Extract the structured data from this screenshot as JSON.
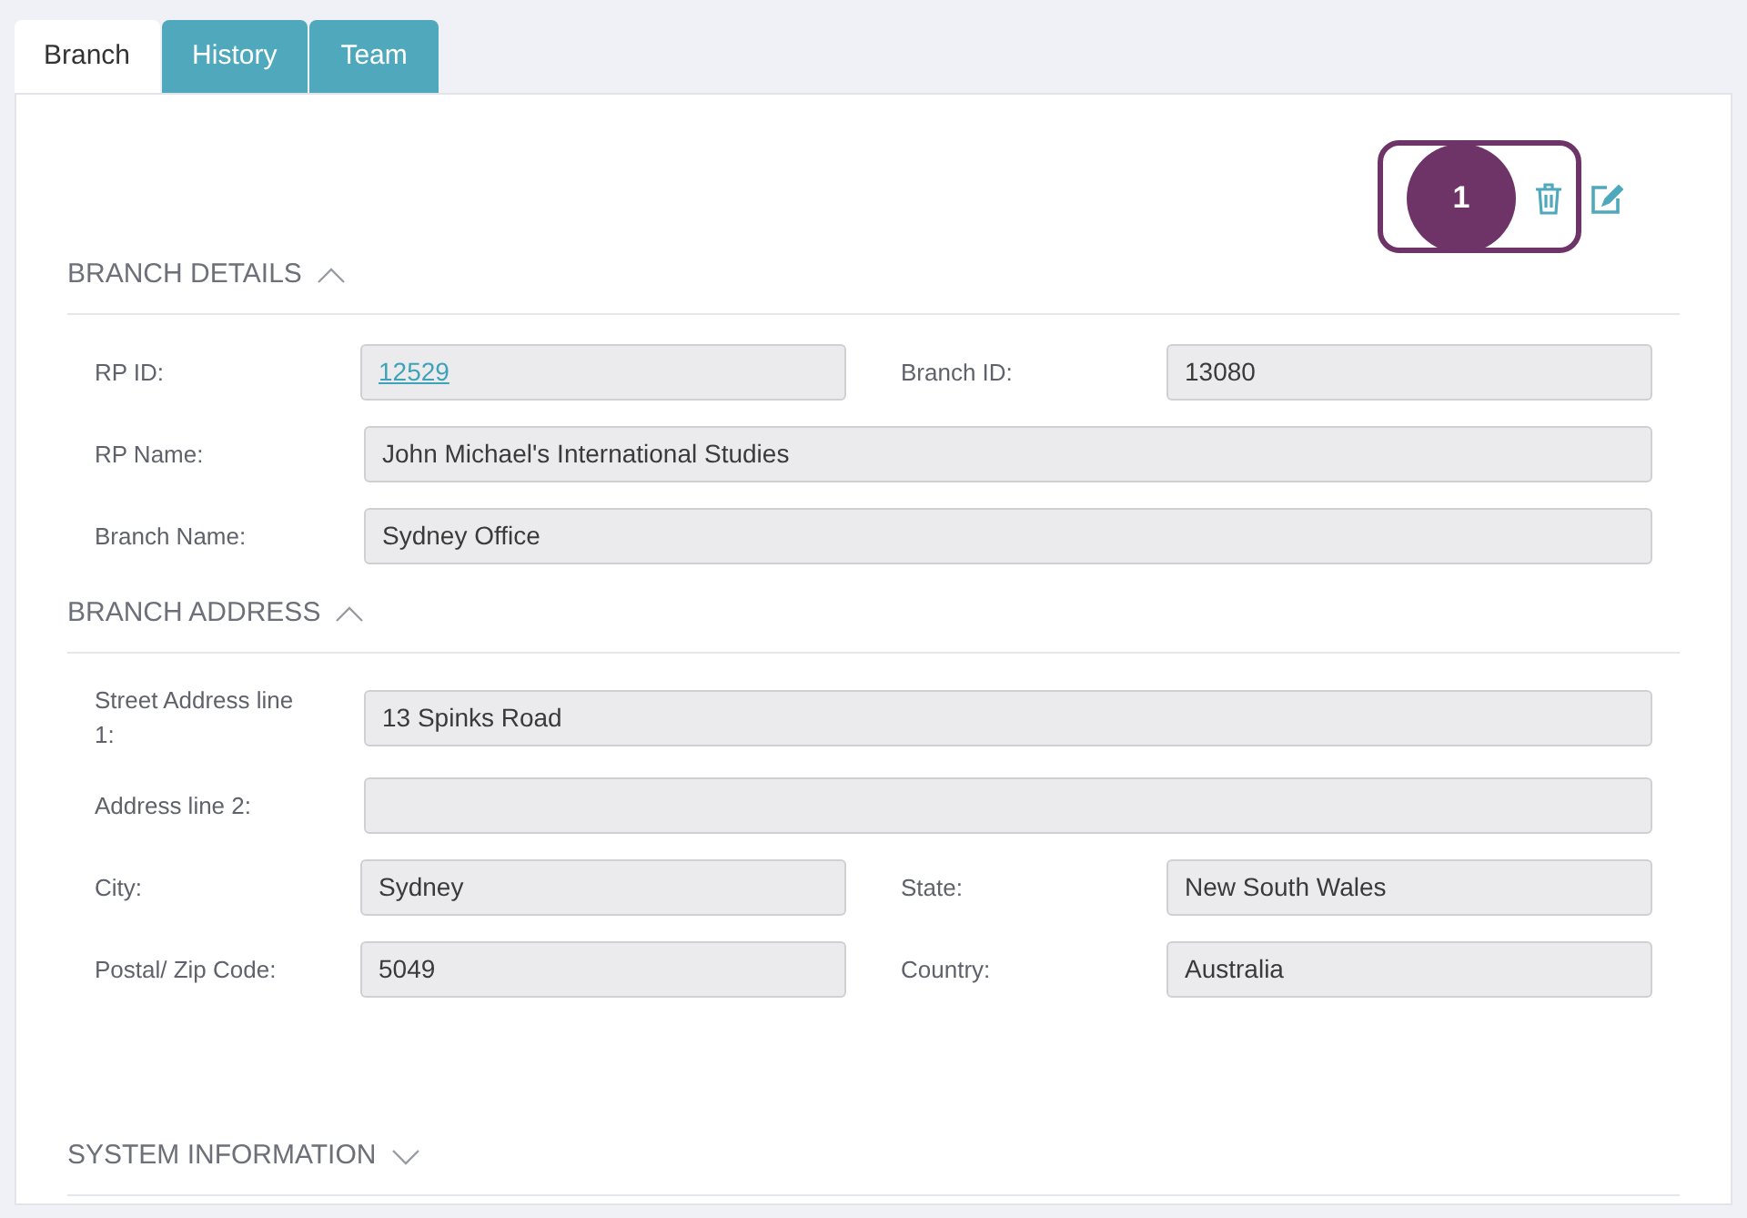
{
  "tabs": [
    {
      "label": "Branch",
      "selected": true
    },
    {
      "label": "History",
      "selected": false
    },
    {
      "label": "Team",
      "selected": false
    }
  ],
  "annotation": {
    "text": "1"
  },
  "sections": [
    {
      "title": "BRANCH DETAILS",
      "expanded": true,
      "rows": [
        {
          "fields": [
            {
              "label": "RP ID:",
              "value": "12529",
              "kind": "link"
            },
            {
              "label": "Branch ID:",
              "value": "13080",
              "kind": "text"
            }
          ]
        },
        {
          "fields": [
            {
              "label": "RP Name:",
              "value": "John Michael's International Studies",
              "kind": "text"
            }
          ]
        },
        {
          "fields": [
            {
              "label": "Branch Name:",
              "value": "Sydney Office",
              "kind": "text"
            }
          ]
        }
      ]
    },
    {
      "title": "BRANCH ADDRESS",
      "expanded": true,
      "rows": [
        {
          "fields": [
            {
              "label": "Street Address line 1:",
              "value": "13 Spinks Road",
              "kind": "text"
            }
          ]
        },
        {
          "fields": [
            {
              "label": "Address line 2:",
              "kind": "text"
            }
          ]
        },
        {
          "fields": [
            {
              "label": "City:",
              "value": "Sydney",
              "kind": "text"
            },
            {
              "label": "State:",
              "value": "New South Wales",
              "kind": "text"
            }
          ]
        },
        {
          "fields": [
            {
              "label": "Postal/ Zip Code:",
              "value": "5049",
              "kind": "text"
            },
            {
              "label": "Country:",
              "value": "Australia",
              "kind": "text"
            }
          ]
        }
      ]
    },
    {
      "title": "SYSTEM INFORMATION",
      "expanded": false
    }
  ]
}
